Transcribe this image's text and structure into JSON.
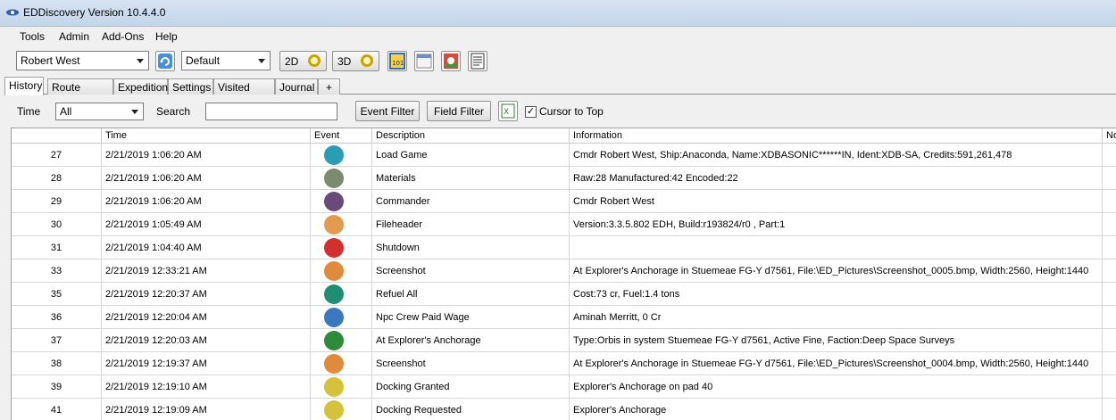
{
  "window": {
    "title": "EDDiscovery Version 10.4.4.0"
  },
  "menu": [
    "Tools",
    "Admin",
    "Add-Ons",
    "Help"
  ],
  "toolbar": {
    "commander": "Robert West",
    "profile": "Default",
    "btn_2d": "2D",
    "btn_3d": "3D"
  },
  "tabs": [
    "History",
    "Route Finder",
    "Expedition",
    "Settings",
    "Visited Stars",
    "Journal",
    "+"
  ],
  "filter": {
    "time_label": "Time",
    "time_value": "All",
    "search_label": "Search",
    "event_filter": "Event Filter",
    "field_filter": "Field Filter",
    "cursor_to_top": "Cursor to Top",
    "cursor_checked": "✓"
  },
  "grid": {
    "headers": [
      "",
      "Time",
      "Event",
      "Description",
      "Information",
      "No"
    ],
    "rows": [
      {
        "n": "27",
        "time": "2/21/2019 1:06:20 AM",
        "icon": "load-game-icon",
        "color": "#2a9db5",
        "desc": "Load Game",
        "info": "Cmdr Robert West, Ship:Anaconda, Name:XDBASONIC******IN, Ident:XDB-SA, Credits:591,261,478"
      },
      {
        "n": "28",
        "time": "2/21/2019 1:06:20 AM",
        "icon": "materials-icon",
        "color": "#7d8a6e",
        "desc": "Materials",
        "info": "Raw:28 Manufactured:42 Encoded:22"
      },
      {
        "n": "29",
        "time": "2/21/2019 1:06:20 AM",
        "icon": "commander-icon",
        "color": "#6a4a7a",
        "desc": "Commander",
        "info": "Cmdr Robert West"
      },
      {
        "n": "30",
        "time": "2/21/2019 1:05:49 AM",
        "icon": "fileheader-icon",
        "color": "#e39a4f",
        "desc": "Fileheader",
        "info": "Version:3.3.5.802 EDH, Build:r193824/r0 , Part:1"
      },
      {
        "n": "31",
        "time": "2/21/2019 1:04:40 AM",
        "icon": "shutdown-icon",
        "color": "#d32f2f",
        "desc": "Shutdown",
        "info": ""
      },
      {
        "n": "33",
        "time": "2/21/2019 12:33:21 AM",
        "icon": "screenshot-icon",
        "color": "#e08a3c",
        "desc": "Screenshot",
        "info": "At Explorer's Anchorage in Stuemeae FG-Y d7561, File:\\ED_Pictures\\Screenshot_0005.bmp, Width:2560, Height:1440"
      },
      {
        "n": "35",
        "time": "2/21/2019 12:20:37 AM",
        "icon": "refuel-icon",
        "color": "#1f8f73",
        "desc": "Refuel All",
        "info": "Cost:73 cr, Fuel:1.4 tons"
      },
      {
        "n": "36",
        "time": "2/21/2019 12:20:04 AM",
        "icon": "crew-wage-icon",
        "color": "#3a78c2",
        "desc": "Npc Crew Paid Wage",
        "info": "Aminah Merritt, 0 Cr"
      },
      {
        "n": "37",
        "time": "2/21/2019 12:20:03 AM",
        "icon": "station-icon",
        "color": "#2e8b3a",
        "desc": "At Explorer's Anchorage",
        "info": "Type:Orbis in system Stuemeae FG-Y d7561, Active Fine, Faction:Deep Space Surveys"
      },
      {
        "n": "38",
        "time": "2/21/2019 12:19:37 AM",
        "icon": "screenshot-icon",
        "color": "#e08a3c",
        "desc": "Screenshot",
        "info": "At Explorer's Anchorage in Stuemeae FG-Y d7561, File:\\ED_Pictures\\Screenshot_0004.bmp, Width:2560, Height:1440"
      },
      {
        "n": "39",
        "time": "2/21/2019 12:19:10 AM",
        "icon": "docking-granted-icon",
        "color": "#d6c23a",
        "desc": "Docking Granted",
        "info": "Explorer's Anchorage on pad 40"
      },
      {
        "n": "41",
        "time": "2/21/2019 12:19:09 AM",
        "icon": "docking-requested-icon",
        "color": "#d6c23a",
        "desc": "Docking Requested",
        "info": "Explorer's Anchorage"
      }
    ]
  }
}
